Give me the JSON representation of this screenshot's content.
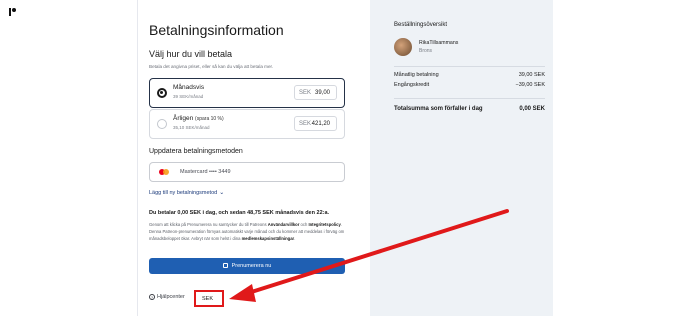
{
  "checkout": {
    "title": "Betalningsinformation",
    "plan_heading": "Välj hur du vill betala",
    "plan_help": "Betala det angivna priset, eller så kan du välja att betala mer.",
    "plans": [
      {
        "name": "Månadsvis",
        "savings": "",
        "sub": "39 SEK/månad",
        "currency": "SEK",
        "price": "39,00",
        "selected": true
      },
      {
        "name": "Årligen",
        "savings": "(spara 10 %)",
        "sub": "35,10 SEK/månad",
        "currency": "SEK",
        "price": "421,20",
        "selected": false
      }
    ],
    "payment_heading": "Uppdatera betalningsmetoden",
    "payment_method": "Mastercard •••• 3449",
    "add_method": "Lägg till ny betalningsmetod",
    "summary_line": "Du betalar 0,00 SEK i dag, och sedan 48,75 SEK månadsvis den 22:a.",
    "terms_part1": "Genom att klicka på Prenumerera nu samtycker du till Patreons ",
    "terms_link1": "Användarvillkor",
    "terms_part2": " och ",
    "terms_link2": "Integritetspolicy",
    "terms_part3": ". Denna Patreon-prenumeration förnyas automatiskt varje månad och du kommer att meddelas i förväg om månadsbeloppet ökar. Avbryt när som helst i dina ",
    "terms_link3": "medlemskapsinställningar",
    "terms_part4": ".",
    "subscribe_label": "Prenumerera nu",
    "help_center": "Hjälpcenter",
    "currency_selected": "SEK"
  },
  "order": {
    "heading": "Beställningsöversikt",
    "creator": "RikaTillsammans",
    "tier": "Brons",
    "rows": [
      {
        "label": "Månatlig betalning",
        "value": "39,00 SEK"
      },
      {
        "label": "Engångskredit",
        "value": "−39,00 SEK"
      }
    ],
    "total_label": "Totalsumma som förfaller i dag",
    "total_value": "0,00 SEK"
  },
  "colors": {
    "accent": "#1f5fb2",
    "annotation": "#e0191a",
    "summary_bg": "#eef2f6"
  }
}
